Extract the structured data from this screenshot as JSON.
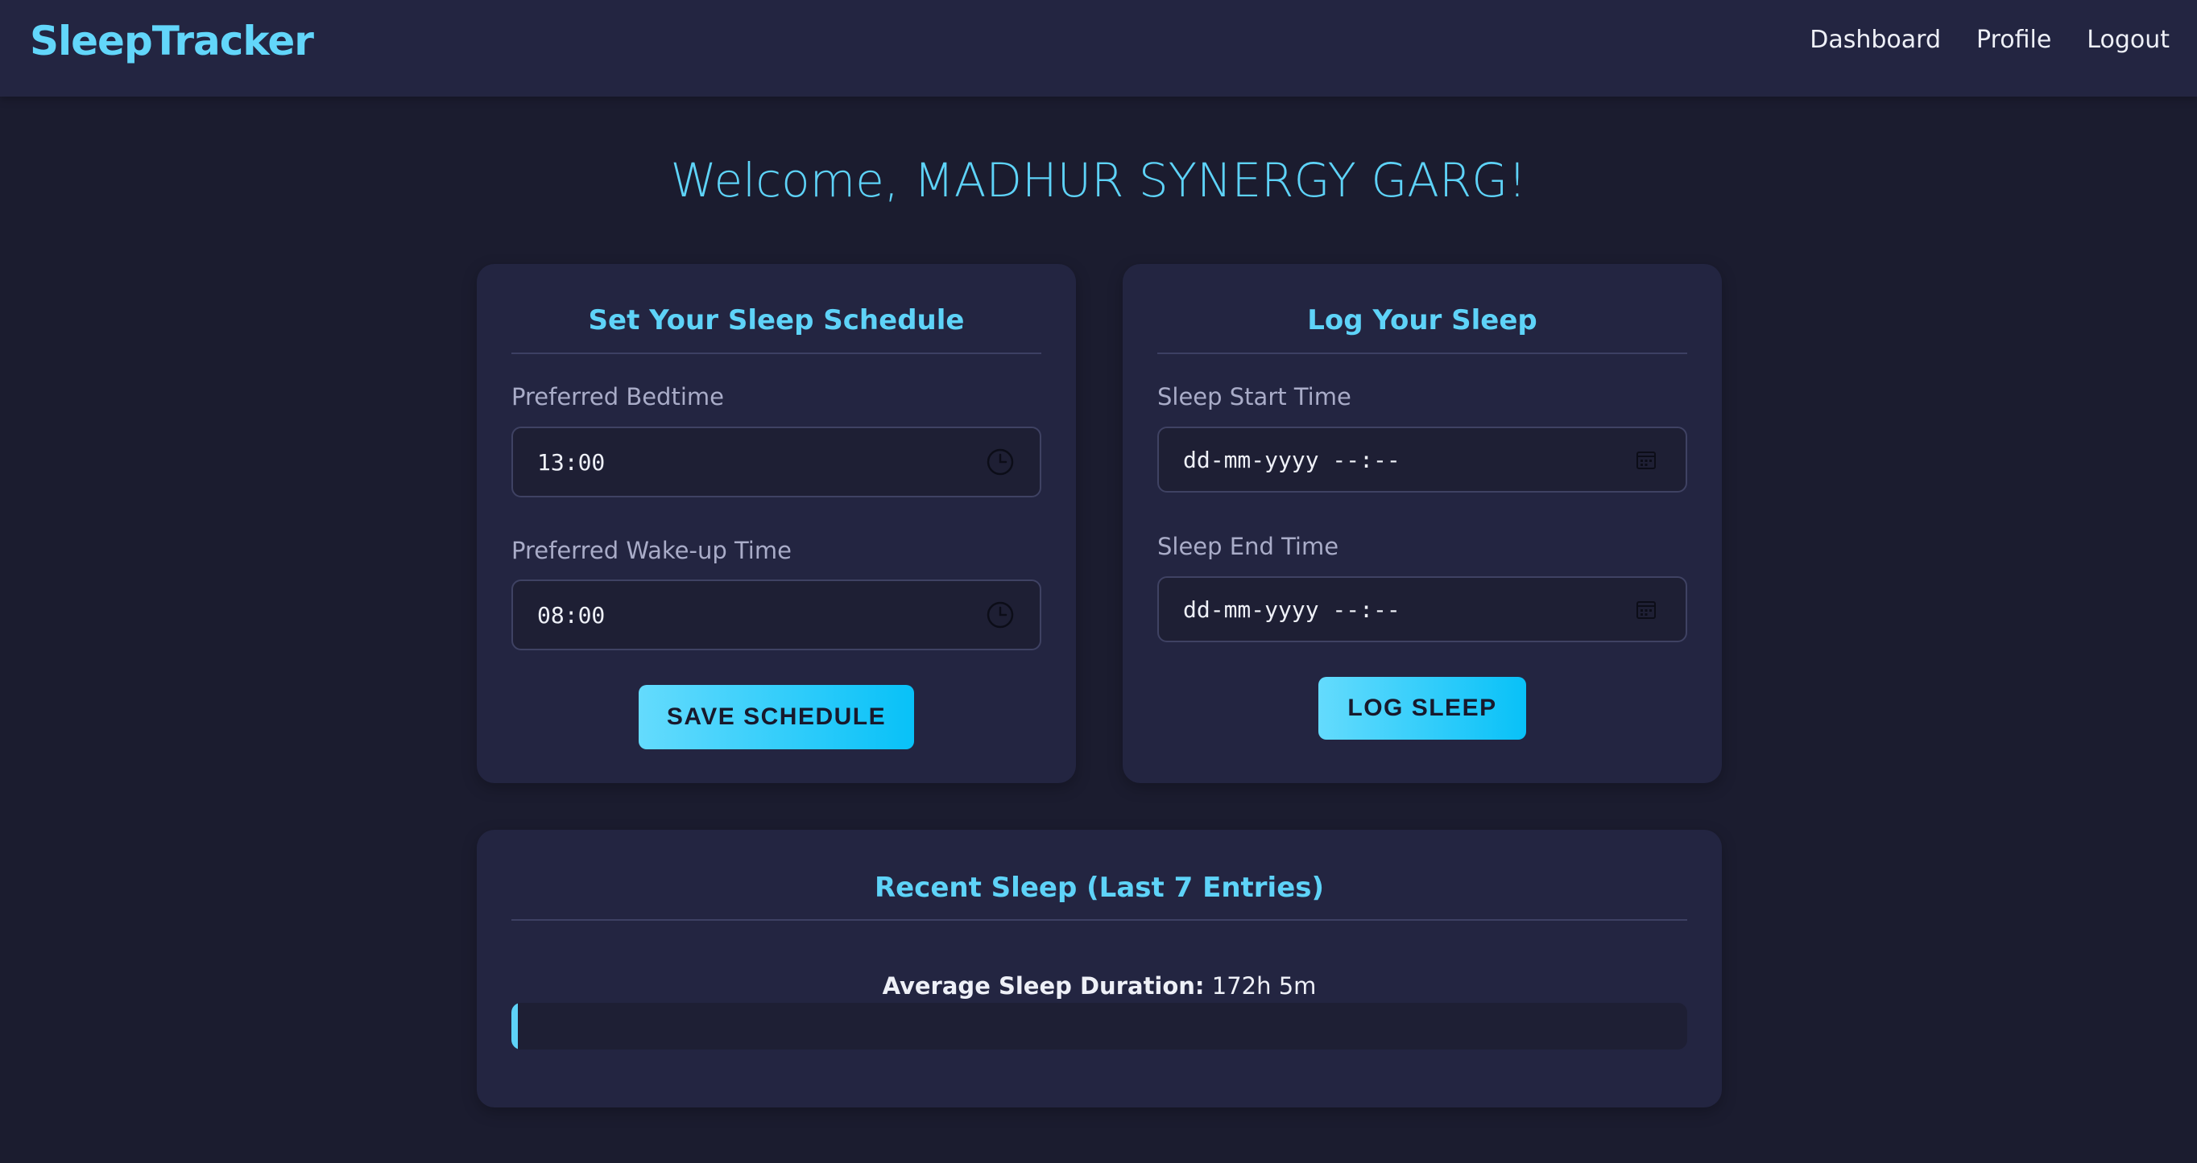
{
  "brand": "SleepTracker",
  "nav": {
    "dashboard": "Dashboard",
    "profile": "Profile",
    "logout": "Logout"
  },
  "welcome": "Welcome, MADHUR SYNERGY GARG!",
  "schedule_card": {
    "title": "Set Your Sleep Schedule",
    "bedtime_label": "Preferred Bedtime",
    "bedtime_value": "13:00",
    "bedtime_icon": "clock-icon",
    "wakeup_label": "Preferred Wake-up Time",
    "wakeup_value": "08:00",
    "wakeup_icon": "clock-icon",
    "button": "SAVE SCHEDULE"
  },
  "log_card": {
    "title": "Log Your Sleep",
    "start_label": "Sleep Start Time",
    "start_value": "dd-mm-yyyy --:--",
    "start_icon": "calendar-icon",
    "end_label": "Sleep End Time",
    "end_value": "dd-mm-yyyy --:--",
    "end_icon": "calendar-icon",
    "button": "LOG SLEEP"
  },
  "recent_card": {
    "title": "Recent Sleep (Last 7 Entries)",
    "avg_label": "Average Sleep Duration:",
    "avg_value": "172h 5m"
  },
  "colors": {
    "accent": "#5ed3f8",
    "background": "#1b1c2f",
    "card": "#232541",
    "button_gradient_start": "#64dbfd",
    "button_gradient_end": "#08c1f8"
  }
}
